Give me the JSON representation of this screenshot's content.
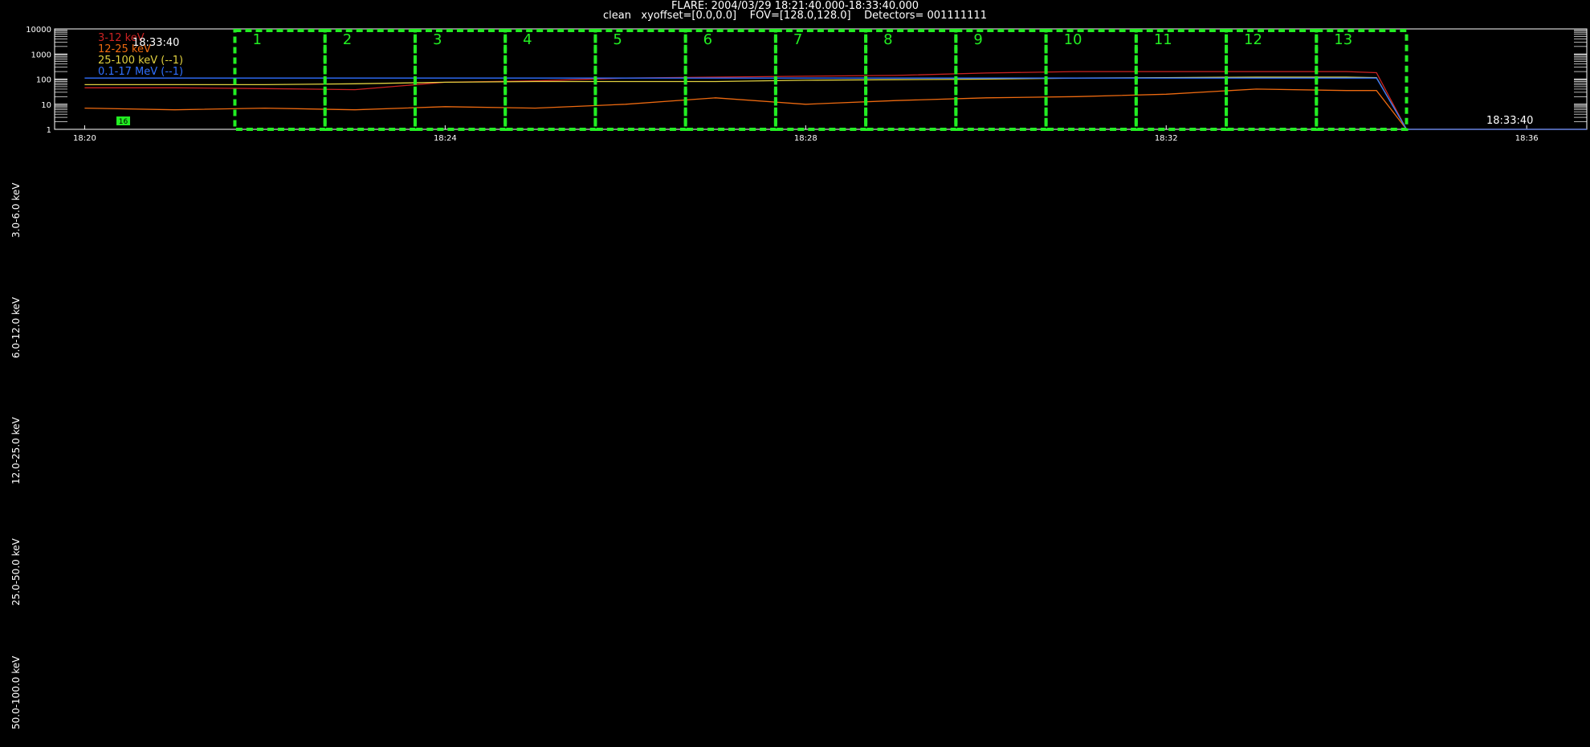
{
  "header": {
    "title": "FLARE: 2004/03/29 18:21:40.000-18:33:40.000",
    "subtitle": "clean   xyoffset=[0.0,0.0]    FOV=[128.0,128.0]    Detectors= 001111111"
  },
  "overlay": {
    "legend_timestamp": "18:33:40",
    "right_timestamp": "18:33:40",
    "marker_badge": "16"
  },
  "colors": {
    "background": "#000000",
    "axis": "#ffffff",
    "interval_box": "#22ee22",
    "series_3_12": "#cc2222",
    "series_12_25": "#ee6a10",
    "series_25_100": "#e0d040",
    "series_0_1_17": "#3070ff"
  },
  "side_labels": [
    "3.0-6.0 keV",
    "6.0-12.0 keV",
    "12.0-25.0 keV",
    "25.0-50.0 keV",
    "50.0-100.0 keV"
  ],
  "chart_data": {
    "type": "line",
    "y_scale": "log",
    "ylim": [
      1,
      10000
    ],
    "y_ticks": [
      "10000",
      "1000",
      "100",
      "10",
      "1"
    ],
    "xlim": [
      "18:19:40",
      "18:36:40"
    ],
    "x_ticks": [
      "18:20",
      "18:24",
      "18:28",
      "18:32",
      "18:36"
    ],
    "x": [
      "18:20:00",
      "18:21:00",
      "18:22:00",
      "18:23:00",
      "18:24:00",
      "18:25:00",
      "18:26:00",
      "18:27:00",
      "18:28:00",
      "18:29:00",
      "18:30:00",
      "18:31:00",
      "18:32:00",
      "18:33:00",
      "18:34:00",
      "18:34:20",
      "18:34:40",
      "18:35:00",
      "18:36:00",
      "18:36:40"
    ],
    "series": [
      {
        "name": "3-12 keV",
        "color_key": "series_3_12",
        "values": [
          45,
          45,
          42,
          38,
          75,
          85,
          110,
          120,
          130,
          140,
          175,
          200,
          200,
          200,
          200,
          180,
          1,
          1,
          1,
          1
        ]
      },
      {
        "name": "12-25 keV",
        "color_key": "series_12_25",
        "values": [
          7,
          6,
          7,
          6,
          8,
          7,
          10,
          18,
          10,
          14,
          18,
          20,
          25,
          40,
          35,
          35,
          1,
          1,
          1,
          1
        ]
      },
      {
        "name": "25-100 keV (--1)",
        "color_key": "series_25_100",
        "values": [
          60,
          60,
          60,
          65,
          75,
          80,
          80,
          80,
          90,
          95,
          100,
          110,
          115,
          120,
          120,
          115,
          1,
          1,
          1,
          1
        ]
      },
      {
        "name": "0.1-17 MeV (--1)",
        "color_key": "series_0_1_17",
        "values": [
          110,
          110,
          110,
          110,
          110,
          110,
          110,
          110,
          110,
          110,
          110,
          110,
          110,
          110,
          110,
          110,
          1,
          1,
          1,
          1
        ]
      }
    ],
    "intervals": [
      {
        "label": "1",
        "start": "18:21:40",
        "end": "18:22:40"
      },
      {
        "label": "2",
        "start": "18:22:40",
        "end": "18:23:40"
      },
      {
        "label": "3",
        "start": "18:23:40",
        "end": "18:24:40"
      },
      {
        "label": "4",
        "start": "18:24:40",
        "end": "18:25:40"
      },
      {
        "label": "5",
        "start": "18:25:40",
        "end": "18:26:40"
      },
      {
        "label": "6",
        "start": "18:26:40",
        "end": "18:27:40"
      },
      {
        "label": "7",
        "start": "18:27:40",
        "end": "18:28:40"
      },
      {
        "label": "8",
        "start": "18:28:40",
        "end": "18:29:40"
      },
      {
        "label": "9",
        "start": "18:29:40",
        "end": "18:30:40"
      },
      {
        "label": "10",
        "start": "18:30:40",
        "end": "18:31:40"
      },
      {
        "label": "11",
        "start": "18:31:40",
        "end": "18:32:40"
      },
      {
        "label": "12",
        "start": "18:32:40",
        "end": "18:33:40"
      },
      {
        "label": "13",
        "start": "18:33:40",
        "end": "18:34:40"
      }
    ]
  }
}
